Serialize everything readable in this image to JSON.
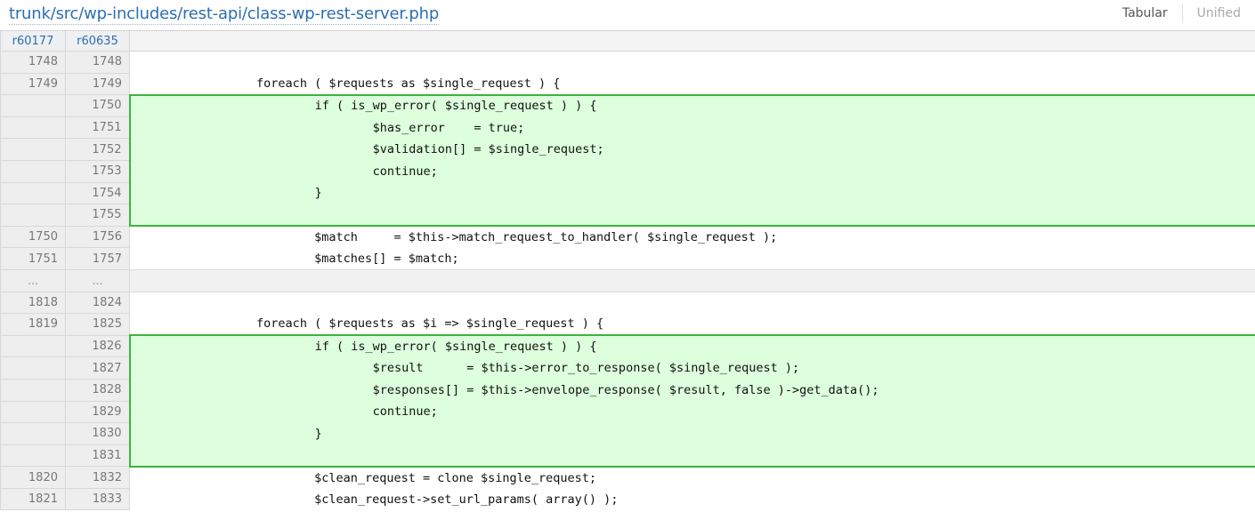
{
  "header": {
    "file_path": "trunk/src/wp-includes/rest-api/class-wp-rest-server.php",
    "tabular_label": "Tabular",
    "unified_label": "Unified"
  },
  "revisions": {
    "old": "r60177",
    "new": "r60635"
  },
  "rows": [
    {
      "type": "context",
      "old": "1748",
      "new": "1748",
      "code": ""
    },
    {
      "type": "context",
      "old": "1749",
      "new": "1749",
      "code": "\t\tforeach ( $requests as $single_request ) {"
    },
    {
      "type": "ins",
      "pos": "first",
      "old": "",
      "new": "1750",
      "code": "\t\t\tif ( is_wp_error( $single_request ) ) {"
    },
    {
      "type": "ins",
      "pos": "",
      "old": "",
      "new": "1751",
      "code": "\t\t\t\t$has_error    = true;"
    },
    {
      "type": "ins",
      "pos": "",
      "old": "",
      "new": "1752",
      "code": "\t\t\t\t$validation[] = $single_request;"
    },
    {
      "type": "ins",
      "pos": "",
      "old": "",
      "new": "1753",
      "code": "\t\t\t\tcontinue;"
    },
    {
      "type": "ins",
      "pos": "",
      "old": "",
      "new": "1754",
      "code": "\t\t\t}"
    },
    {
      "type": "ins",
      "pos": "last",
      "old": "",
      "new": "1755",
      "code": ""
    },
    {
      "type": "context",
      "old": "1750",
      "new": "1756",
      "code": "\t\t\t$match     = $this->match_request_to_handler( $single_request );"
    },
    {
      "type": "context",
      "old": "1751",
      "new": "1757",
      "code": "\t\t\t$matches[] = $match;"
    },
    {
      "type": "skip",
      "old": "…",
      "new": "…",
      "code": ""
    },
    {
      "type": "context",
      "old": "1818",
      "new": "1824",
      "code": ""
    },
    {
      "type": "context",
      "old": "1819",
      "new": "1825",
      "code": "\t\tforeach ( $requests as $i => $single_request ) {"
    },
    {
      "type": "ins",
      "pos": "first",
      "old": "",
      "new": "1826",
      "code": "\t\t\tif ( is_wp_error( $single_request ) ) {"
    },
    {
      "type": "ins",
      "pos": "",
      "old": "",
      "new": "1827",
      "code": "\t\t\t\t$result      = $this->error_to_response( $single_request );"
    },
    {
      "type": "ins",
      "pos": "",
      "old": "",
      "new": "1828",
      "code": "\t\t\t\t$responses[] = $this->envelope_response( $result, false )->get_data();"
    },
    {
      "type": "ins",
      "pos": "",
      "old": "",
      "new": "1829",
      "code": "\t\t\t\tcontinue;"
    },
    {
      "type": "ins",
      "pos": "",
      "old": "",
      "new": "1830",
      "code": "\t\t\t}"
    },
    {
      "type": "ins",
      "pos": "last",
      "old": "",
      "new": "1831",
      "code": ""
    },
    {
      "type": "context",
      "old": "1820",
      "new": "1832",
      "code": "\t\t\t$clean_request = clone $single_request;"
    },
    {
      "type": "context",
      "old": "1821",
      "new": "1833",
      "code": "\t\t\t$clean_request->set_url_params( array() );"
    }
  ]
}
